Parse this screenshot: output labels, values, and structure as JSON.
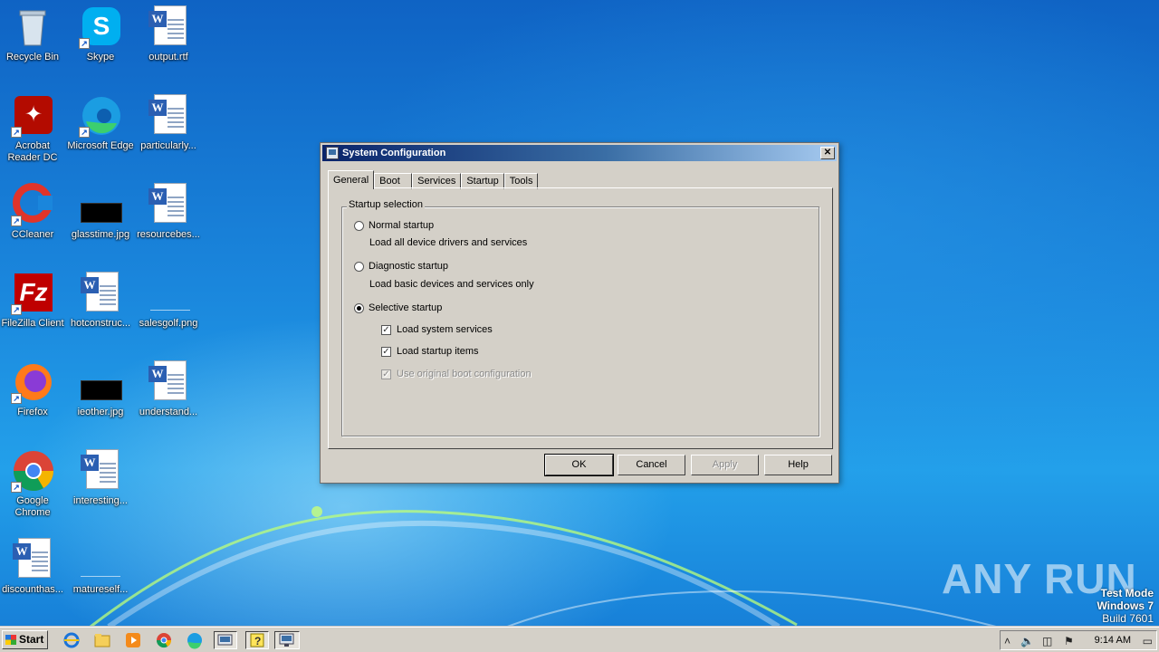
{
  "desktop": {
    "icons": [
      {
        "label": "Recycle Bin",
        "icon": "recycle-bin-icon"
      },
      {
        "label": "Skype",
        "icon": "skype-icon"
      },
      {
        "label": "output.rtf",
        "icon": "word-document-icon"
      },
      {
        "label": "Acrobat Reader DC",
        "icon": "acrobat-icon"
      },
      {
        "label": "Microsoft Edge",
        "icon": "edge-icon"
      },
      {
        "label": "particularly...",
        "icon": "word-document-icon"
      },
      {
        "label": "CCleaner",
        "icon": "ccleaner-icon"
      },
      {
        "label": "glasstime.jpg",
        "icon": "image-file-icon"
      },
      {
        "label": "resourcebes...",
        "icon": "word-document-icon"
      },
      {
        "label": "FileZilla Client",
        "icon": "filezilla-icon"
      },
      {
        "label": "hotconstruc...",
        "icon": "word-document-icon"
      },
      {
        "label": "salesgolf.png",
        "icon": "image-file-icon"
      },
      {
        "label": "Firefox",
        "icon": "firefox-icon"
      },
      {
        "label": "ieother.jpg",
        "icon": "image-file-icon"
      },
      {
        "label": "understand...",
        "icon": "word-document-icon"
      },
      {
        "label": "Google Chrome",
        "icon": "chrome-icon"
      },
      {
        "label": "interesting...",
        "icon": "word-document-icon"
      },
      {
        "label": "discounthas...",
        "icon": "word-document-icon"
      },
      {
        "label": "matureself...",
        "icon": "image-file-icon"
      }
    ],
    "watermark": "ANY RUN",
    "test_mode": {
      "line1": "Test Mode",
      "line2": "Windows 7",
      "line3": "Build 7601"
    }
  },
  "window": {
    "title": "System Configuration",
    "close_glyph": "✕",
    "tabs": [
      "General",
      "Boot",
      "Services",
      "Startup",
      "Tools"
    ],
    "active_tab": "General",
    "group_label": "Startup selection",
    "options": {
      "normal": {
        "label": "Normal startup",
        "desc": "Load all device drivers and services",
        "selected": false
      },
      "diagnostic": {
        "label": "Diagnostic startup",
        "desc": "Load basic devices and services only",
        "selected": false
      },
      "selective": {
        "label": "Selective startup",
        "selected": true
      }
    },
    "checks": {
      "system_services": {
        "label": "Load system services",
        "checked": true,
        "enabled": true
      },
      "startup_items": {
        "label": "Load startup items",
        "checked": true,
        "enabled": true
      },
      "boot_config": {
        "label": "Use original boot configuration",
        "checked": true,
        "enabled": false
      }
    },
    "buttons": {
      "ok": "OK",
      "cancel": "Cancel",
      "apply": "Apply",
      "help": "Help"
    }
  },
  "taskbar": {
    "start_label": "Start",
    "pinned": [
      "internet-explorer-icon",
      "file-explorer-icon",
      "media-player-icon",
      "chrome-icon",
      "edge-icon",
      "msconfig-icon",
      "help-icon",
      "system-config-icon"
    ],
    "clock": "9:14 AM"
  },
  "colors": {
    "desktop_blue": "#1a86dc",
    "dialog_gray": "#d4d0c8",
    "title_blue": "#0a246a"
  }
}
